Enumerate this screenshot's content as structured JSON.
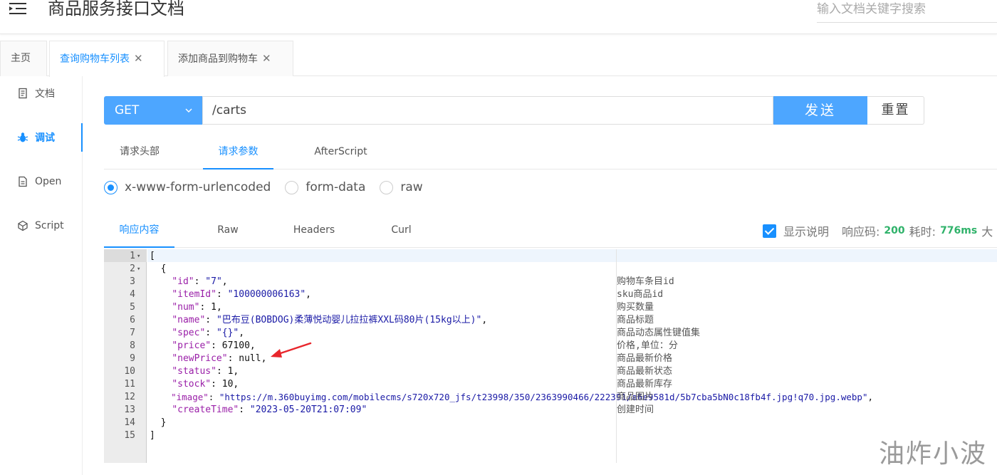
{
  "header": {
    "title": "商品服务接口文档",
    "search_placeholder": "输入文档关键字搜索",
    "menu_icon": "menu-fold-icon"
  },
  "tabs": [
    {
      "label": "主页",
      "closable": false,
      "active": false
    },
    {
      "label": "查询购物车列表",
      "closable": true,
      "active": true
    },
    {
      "label": "添加商品到购物车",
      "closable": true,
      "active": false
    }
  ],
  "sidebar": {
    "items": [
      {
        "label": "文档",
        "icon": "document-icon",
        "active": false
      },
      {
        "label": "调试",
        "icon": "bug-icon",
        "active": true
      },
      {
        "label": "Open",
        "icon": "file-icon",
        "active": false
      },
      {
        "label": "Script",
        "icon": "code-sandbox-icon",
        "active": false
      }
    ]
  },
  "request": {
    "method": "GET",
    "url": "/carts",
    "send_label": "发送",
    "reset_label": "重置"
  },
  "request_tabs": [
    "请求头部",
    "请求参数",
    "AfterScript"
  ],
  "content_types": [
    {
      "label": "x-www-form-urlencoded",
      "checked": true
    },
    {
      "label": "form-data",
      "checked": false
    },
    {
      "label": "raw",
      "checked": false
    }
  ],
  "response_tabs": [
    "响应内容",
    "Raw",
    "Headers",
    "Curl"
  ],
  "response_meta": {
    "show_desc_label": "显示说明",
    "status_label": "响应码:",
    "status_value": "200",
    "time_label": "耗时:",
    "time_value": "776ms",
    "size_label": "大"
  },
  "code": {
    "line_numbers": [
      "1",
      "2",
      "3",
      "4",
      "5",
      "6",
      "7",
      "8",
      "9",
      "10",
      "11",
      "12",
      "13",
      "14",
      "15"
    ],
    "fields": {
      "id": "7",
      "itemId": "100000006163",
      "num": "1",
      "name": "巴布豆(BOBDOG)柔薄悦动婴儿拉拉裤XXL码80片(15kg以上)",
      "spec": "{}",
      "price": "67100",
      "newPrice": "null",
      "status": "1",
      "stock": "10",
      "image": "https://m.360buyimg.com/mobilecms/s720x720_jfs/t23998/350/2363990466/222391/a6e9581d/5b7cba5bN0c18fb4f.jpg!q70.jpg.webp",
      "createTime": "2023-05-20T21:07:09"
    },
    "comments": [
      "购物车条目id",
      "sku商品id",
      "购买数量",
      "商品标题",
      "商品动态属性键值集",
      "价格,单位：分",
      "商品最新价格",
      "商品最新状态",
      "商品最新库存",
      "商品图片",
      "创建时间"
    ]
  },
  "watermark": "油炸小波",
  "colors": {
    "accent": "#1890ff",
    "button": "#4da6ff",
    "success": "#2fb26a",
    "annotation_arrow": "#e8262c"
  }
}
